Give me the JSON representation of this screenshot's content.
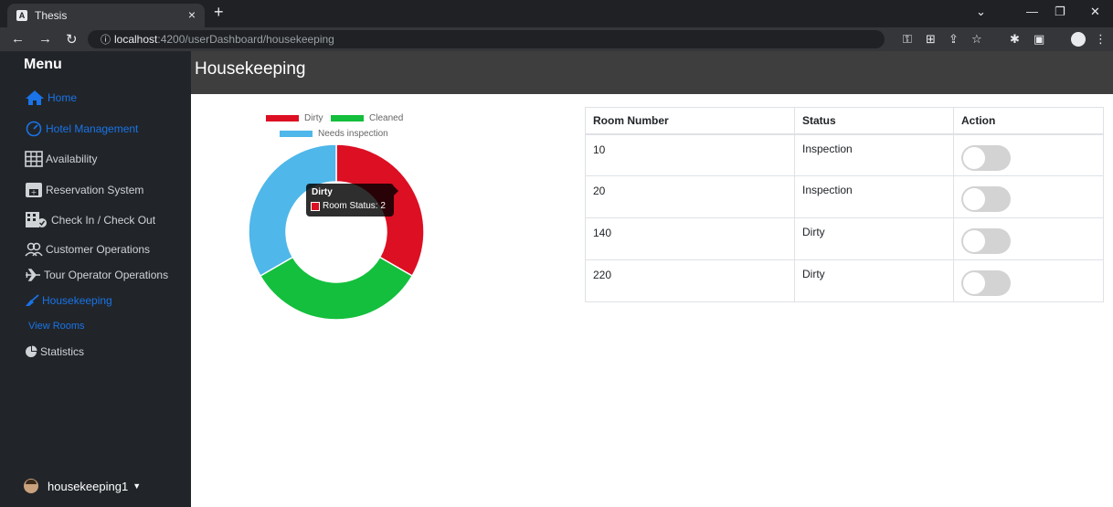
{
  "browser": {
    "tab_title": "Thesis",
    "tab_icon_letter": "A",
    "url_host": "localhost",
    "url_rest": ":4200/userDashboard/housekeeping"
  },
  "sidebar": {
    "title": "Menu",
    "items": [
      {
        "label": "Home",
        "icon": "home-icon",
        "active": true
      },
      {
        "label": "Hotel Management",
        "icon": "dashboard-icon",
        "active": true
      },
      {
        "label": "Availability",
        "icon": "table-icon",
        "active": false
      },
      {
        "label": "Reservation System",
        "icon": "calendar-icon",
        "active": false
      },
      {
        "label": "Check In / Check Out",
        "icon": "building-check-icon",
        "active": false
      },
      {
        "label": "Customer Operations",
        "icon": "users-icon",
        "active": false
      },
      {
        "label": "Tour Operator Operations",
        "icon": "plane-icon",
        "active": false
      },
      {
        "label": "Housekeeping",
        "icon": "broom-icon",
        "active": true
      },
      {
        "label": "Statistics",
        "icon": "pie-chart-icon",
        "active": false
      }
    ],
    "submenu": {
      "label": "View Rooms"
    },
    "user": {
      "name": "housekeeping1"
    }
  },
  "page": {
    "title": "Housekeeping"
  },
  "chart_data": {
    "type": "pie",
    "categories": [
      "Dirty",
      "Cleaned",
      "Needs inspection"
    ],
    "values": [
      2,
      2,
      2
    ],
    "colors": [
      "#dc0f23",
      "#13bf3c",
      "#4fb7e9"
    ],
    "legend_position": "top",
    "tooltip": {
      "title": "Dirty",
      "label": "Room Status: 2"
    }
  },
  "table": {
    "headers": [
      "Room Number",
      "Status",
      "Action"
    ],
    "rows": [
      {
        "room": "10",
        "status": "Inspection",
        "toggle_on": false
      },
      {
        "room": "20",
        "status": "Inspection",
        "toggle_on": false
      },
      {
        "room": "140",
        "status": "Dirty",
        "toggle_on": false
      },
      {
        "room": "220",
        "status": "Dirty",
        "toggle_on": false
      }
    ]
  }
}
